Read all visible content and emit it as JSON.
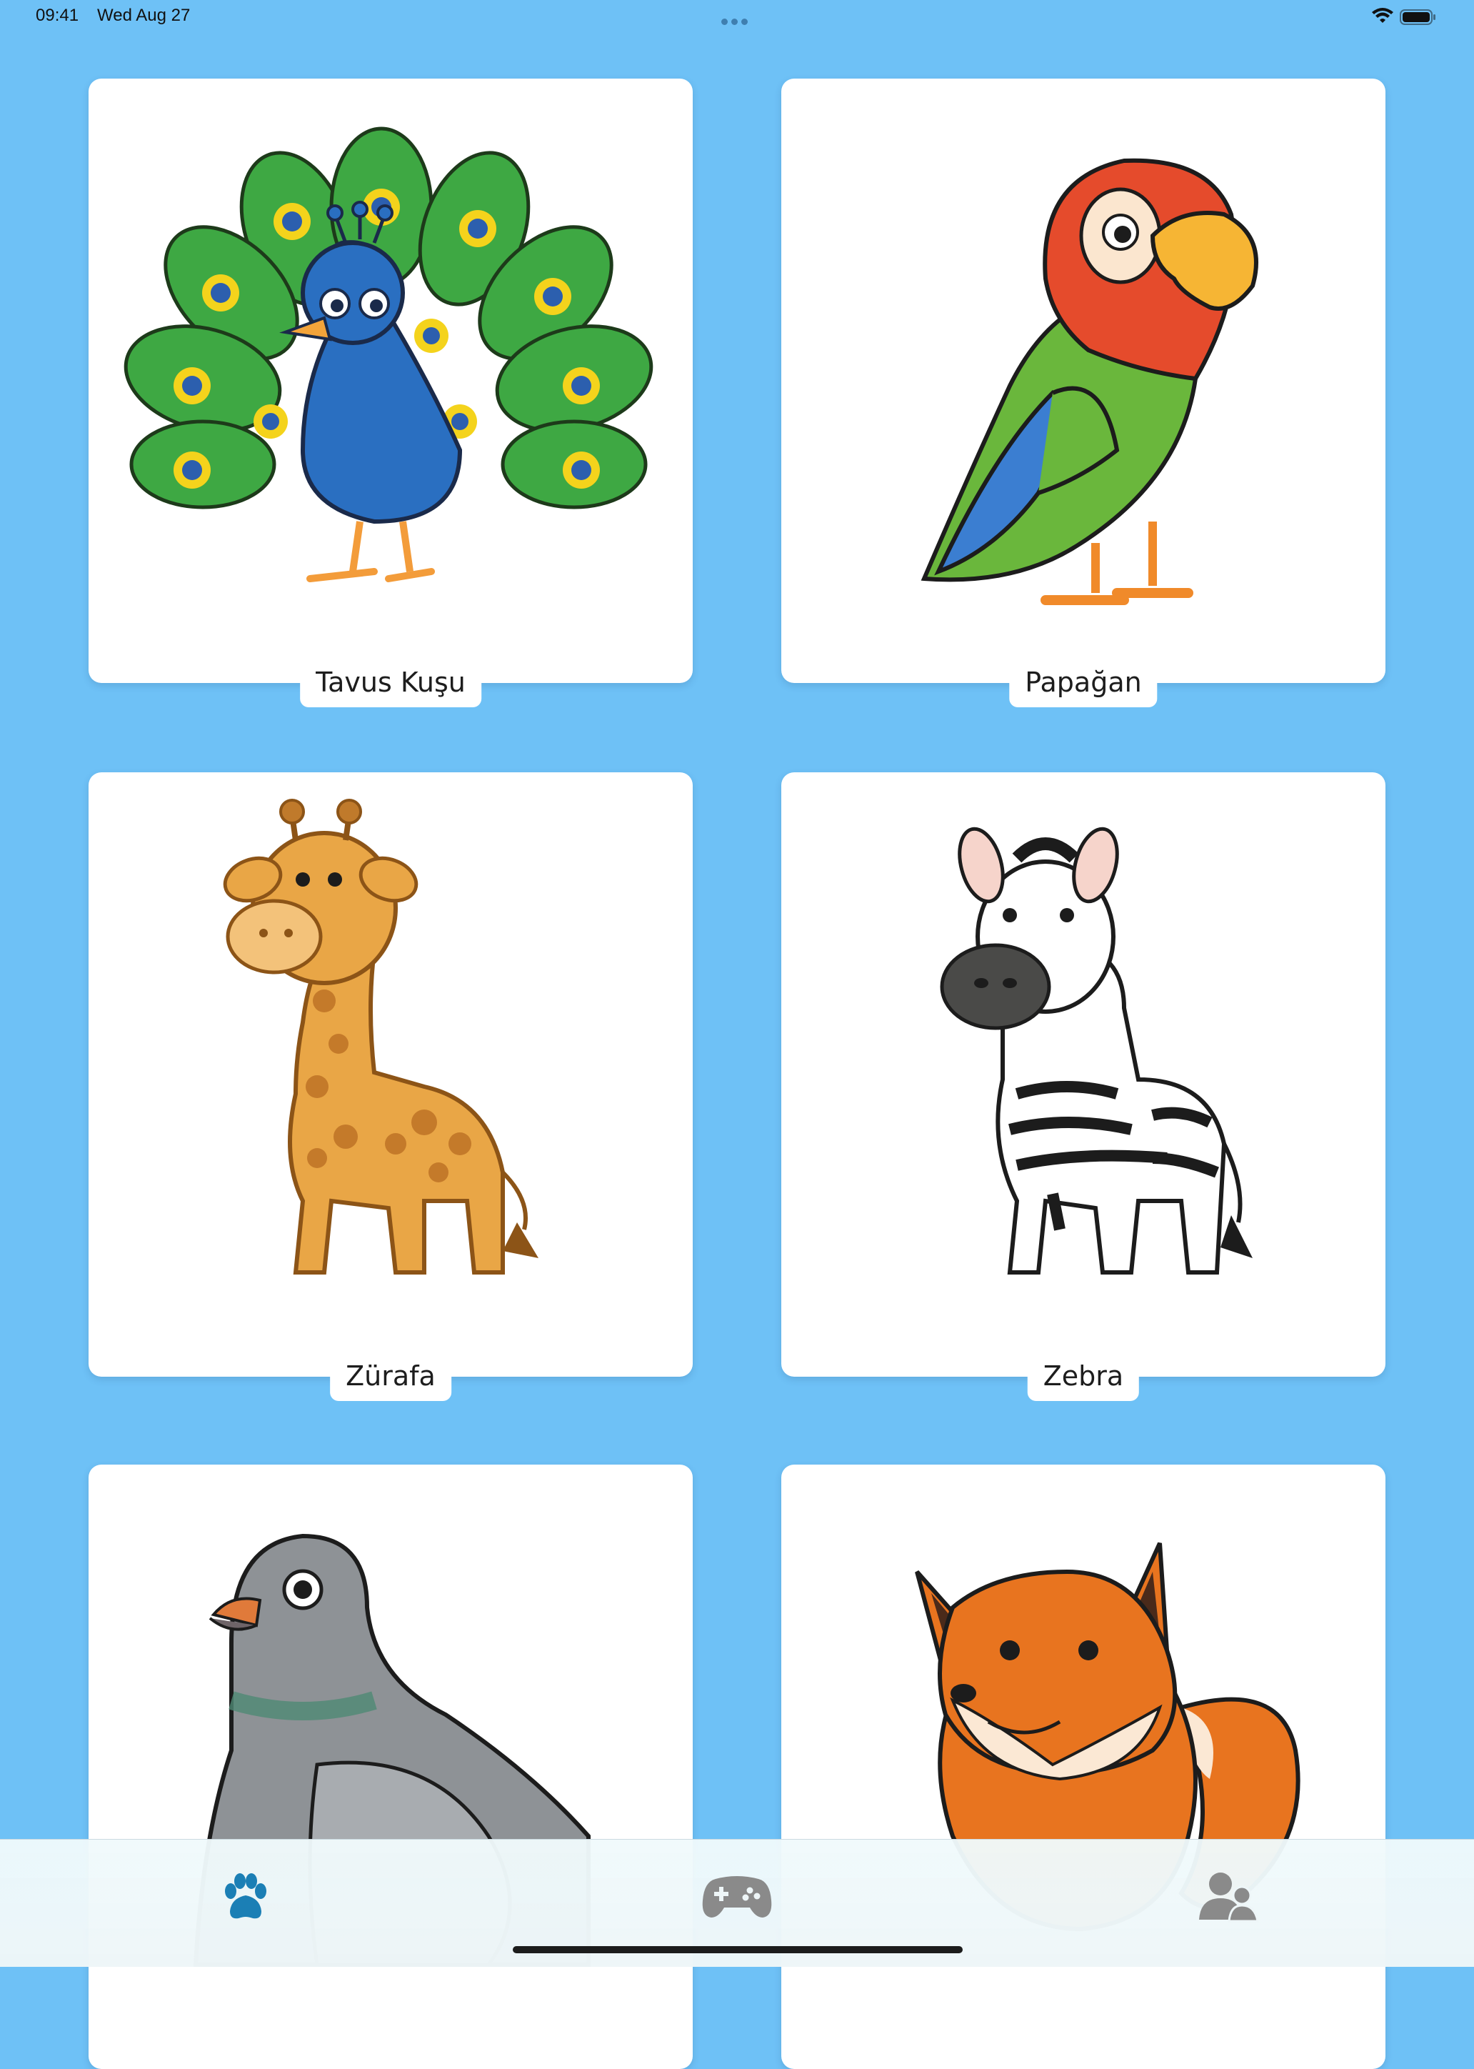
{
  "status_bar": {
    "time": "09:41",
    "date": "Wed Aug 27"
  },
  "animals": [
    {
      "label": "Tavus Kuşu",
      "icon": "peacock-illustration"
    },
    {
      "label": "Papağan",
      "icon": "parrot-illustration"
    },
    {
      "label": "Zürafa",
      "icon": "giraffe-illustration"
    },
    {
      "label": "Zebra",
      "icon": "zebra-illustration"
    },
    {
      "label": "",
      "icon": "pigeon-illustration"
    },
    {
      "label": "",
      "icon": "fox-illustration"
    }
  ],
  "tab_bar": {
    "tabs": [
      {
        "icon": "paw-icon",
        "selected": true
      },
      {
        "icon": "gamepad-icon",
        "selected": false
      },
      {
        "icon": "users-icon",
        "selected": false
      }
    ]
  },
  "colors": {
    "background": "#6ec1f6",
    "selected_tab": "#1b7fb5",
    "unselected_tab": "#8a8a8a"
  }
}
